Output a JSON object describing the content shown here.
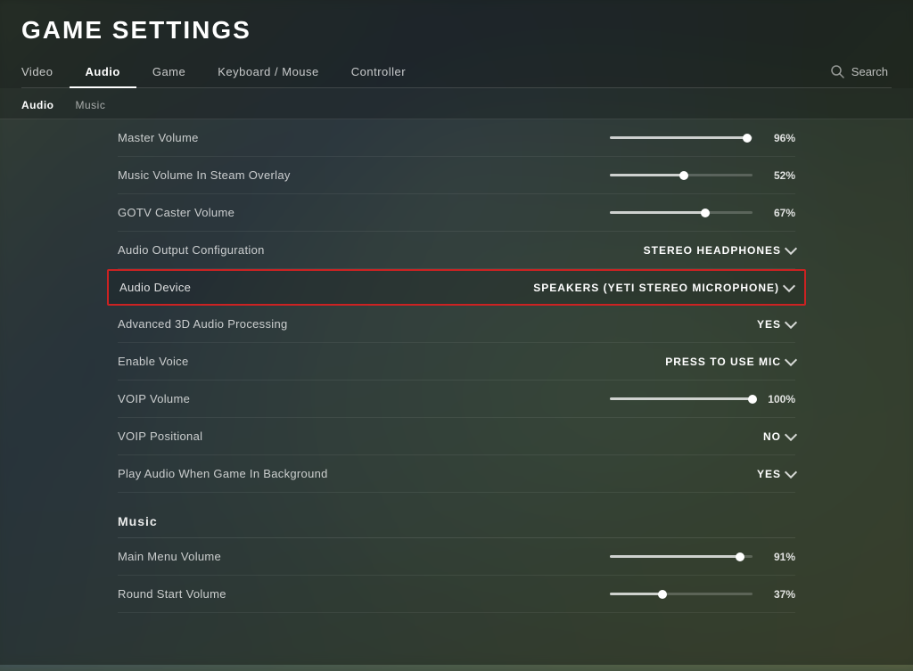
{
  "page": {
    "title": "GAME SETTINGS"
  },
  "main_nav": {
    "tabs": [
      {
        "id": "video",
        "label": "Video",
        "active": false
      },
      {
        "id": "audio",
        "label": "Audio",
        "active": true
      },
      {
        "id": "game",
        "label": "Game",
        "active": false
      },
      {
        "id": "keyboard_mouse",
        "label": "Keyboard / Mouse",
        "active": false
      },
      {
        "id": "controller",
        "label": "Controller",
        "active": false
      }
    ],
    "search_label": "Search"
  },
  "sub_nav": {
    "tabs": [
      {
        "id": "audio",
        "label": "Audio",
        "active": true
      },
      {
        "id": "music",
        "label": "Music",
        "active": false
      }
    ]
  },
  "settings": {
    "audio_section": {
      "rows": [
        {
          "id": "master_volume",
          "label": "Master Volume",
          "type": "slider",
          "value": 96,
          "display": "96%"
        },
        {
          "id": "music_volume_steam",
          "label": "Music Volume In Steam Overlay",
          "type": "slider",
          "value": 52,
          "display": "52%"
        },
        {
          "id": "gotv_caster_volume",
          "label": "GOTV Caster Volume",
          "type": "slider",
          "value": 67,
          "display": "67%"
        },
        {
          "id": "audio_output_config",
          "label": "Audio Output Configuration",
          "type": "dropdown",
          "value": "STEREO HEADPHONES",
          "highlighted": false
        },
        {
          "id": "audio_device",
          "label": "Audio Device",
          "type": "dropdown",
          "value": "SPEAKERS (YETI STEREO MICROPHONE)",
          "highlighted": true
        },
        {
          "id": "advanced_3d_audio",
          "label": "Advanced 3D Audio Processing",
          "type": "dropdown",
          "value": "YES",
          "highlighted": false
        },
        {
          "id": "enable_voice",
          "label": "Enable Voice",
          "type": "dropdown",
          "value": "PRESS TO USE MIC",
          "highlighted": false
        },
        {
          "id": "voip_volume",
          "label": "VOIP Volume",
          "type": "slider",
          "value": 100,
          "display": "100%"
        },
        {
          "id": "voip_positional",
          "label": "VOIP Positional",
          "type": "dropdown",
          "value": "NO",
          "highlighted": false
        },
        {
          "id": "play_audio_background",
          "label": "Play Audio When Game In Background",
          "type": "dropdown",
          "value": "YES",
          "highlighted": false
        }
      ]
    },
    "music_section": {
      "header": "Music",
      "rows": [
        {
          "id": "main_menu_volume",
          "label": "Main Menu Volume",
          "type": "slider",
          "value": 91,
          "display": "91%"
        },
        {
          "id": "round_start_volume",
          "label": "Round Start Volume",
          "type": "slider",
          "value": 37,
          "display": "37%"
        }
      ]
    }
  }
}
